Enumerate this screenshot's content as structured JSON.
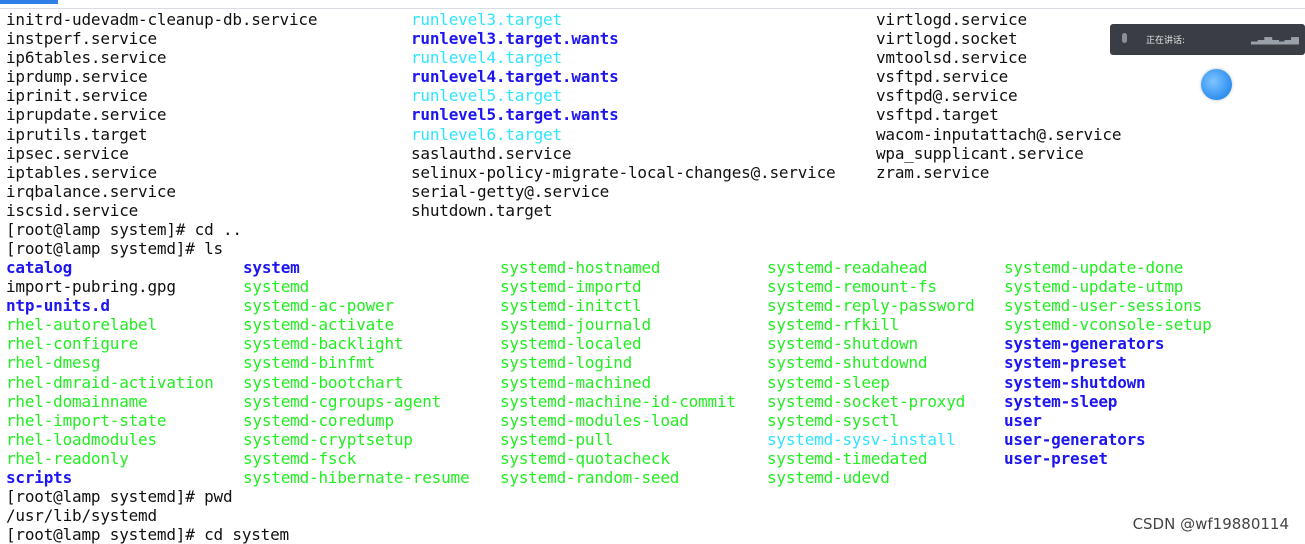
{
  "window": {
    "accent_color": "#2f7fe6"
  },
  "colors": {
    "cyan": "#2fe4ff",
    "bold_blue": "#1e16f0",
    "green": "#22ee22",
    "text": "#111111"
  },
  "listing1": {
    "col1": [
      "initrd-udevadm-cleanup-db.service",
      "instperf.service",
      "ip6tables.service",
      "iprdump.service",
      "iprinit.service",
      "iprupdate.service",
      "iprutils.target",
      "ipsec.service",
      "iptables.service",
      "irqbalance.service",
      "iscsid.service"
    ],
    "col2": [
      {
        "text": "runlevel3.target",
        "style": "cyan"
      },
      {
        "text": "runlevel3.target.wants",
        "style": "bblue"
      },
      {
        "text": "runlevel4.target",
        "style": "cyan"
      },
      {
        "text": "runlevel4.target.wants",
        "style": "bblue"
      },
      {
        "text": "runlevel5.target",
        "style": "cyan"
      },
      {
        "text": "runlevel5.target.wants",
        "style": "bblue"
      },
      {
        "text": "runlevel6.target",
        "style": "cyan"
      },
      {
        "text": "saslauthd.service",
        "style": ""
      },
      {
        "text": "selinux-policy-migrate-local-changes@.service",
        "style": ""
      },
      {
        "text": "serial-getty@.service",
        "style": ""
      },
      {
        "text": "shutdown.target",
        "style": ""
      }
    ],
    "col3": [
      "virtlogd.service",
      "virtlogd.socket",
      "vmtoolsd.service",
      "vsftpd.service",
      "vsftpd@.service",
      "vsftpd.target",
      "wacom-inputattach@.service",
      "wpa_supplicant.service",
      "zram.service"
    ]
  },
  "prompt_lines": {
    "cd_up": "[root@lamp system]# cd ..",
    "ls_cmd": "[root@lamp systemd]# ls",
    "pwd_cmd": "[root@lamp systemd]# pwd",
    "pwd_out": "/usr/lib/systemd",
    "cd_system": "[root@lamp systemd]# cd system"
  },
  "listing2": {
    "col1": [
      {
        "text": "catalog",
        "style": "bblue"
      },
      {
        "text": "import-pubring.gpg",
        "style": ""
      },
      {
        "text": "ntp-units.d",
        "style": "bblue"
      },
      {
        "text": "rhel-autorelabel",
        "style": "green"
      },
      {
        "text": "rhel-configure",
        "style": "green"
      },
      {
        "text": "rhel-dmesg",
        "style": "green"
      },
      {
        "text": "rhel-dmraid-activation",
        "style": "green"
      },
      {
        "text": "rhel-domainname",
        "style": "green"
      },
      {
        "text": "rhel-import-state",
        "style": "green"
      },
      {
        "text": "rhel-loadmodules",
        "style": "green"
      },
      {
        "text": "rhel-readonly",
        "style": "green"
      },
      {
        "text": "scripts",
        "style": "bblue"
      }
    ],
    "col2": [
      {
        "text": "system",
        "style": "bblue"
      },
      {
        "text": "systemd",
        "style": "green"
      },
      {
        "text": "systemd-ac-power",
        "style": "green"
      },
      {
        "text": "systemd-activate",
        "style": "green"
      },
      {
        "text": "systemd-backlight",
        "style": "green"
      },
      {
        "text": "systemd-binfmt",
        "style": "green"
      },
      {
        "text": "systemd-bootchart",
        "style": "green"
      },
      {
        "text": "systemd-cgroups-agent",
        "style": "green"
      },
      {
        "text": "systemd-coredump",
        "style": "green"
      },
      {
        "text": "systemd-cryptsetup",
        "style": "green"
      },
      {
        "text": "systemd-fsck",
        "style": "green"
      },
      {
        "text": "systemd-hibernate-resume",
        "style": "green"
      }
    ],
    "col3": [
      {
        "text": "systemd-hostnamed",
        "style": "green"
      },
      {
        "text": "systemd-importd",
        "style": "green"
      },
      {
        "text": "systemd-initctl",
        "style": "green"
      },
      {
        "text": "systemd-journald",
        "style": "green"
      },
      {
        "text": "systemd-localed",
        "style": "green"
      },
      {
        "text": "systemd-logind",
        "style": "green"
      },
      {
        "text": "systemd-machined",
        "style": "green"
      },
      {
        "text": "systemd-machine-id-commit",
        "style": "green"
      },
      {
        "text": "systemd-modules-load",
        "style": "green"
      },
      {
        "text": "systemd-pull",
        "style": "green"
      },
      {
        "text": "systemd-quotacheck",
        "style": "green"
      },
      {
        "text": "systemd-random-seed",
        "style": "green"
      }
    ],
    "col4": [
      {
        "text": "systemd-readahead",
        "style": "green"
      },
      {
        "text": "systemd-remount-fs",
        "style": "green"
      },
      {
        "text": "systemd-reply-password",
        "style": "green"
      },
      {
        "text": "systemd-rfkill",
        "style": "green"
      },
      {
        "text": "systemd-shutdown",
        "style": "green"
      },
      {
        "text": "systemd-shutdownd",
        "style": "green"
      },
      {
        "text": "systemd-sleep",
        "style": "green"
      },
      {
        "text": "systemd-socket-proxyd",
        "style": "green"
      },
      {
        "text": "systemd-sysctl",
        "style": "green"
      },
      {
        "text": "systemd-sysv-install",
        "style": "cyan"
      },
      {
        "text": "systemd-timedated",
        "style": "green"
      },
      {
        "text": "systemd-udevd",
        "style": "green"
      }
    ],
    "col5": [
      {
        "text": "systemd-update-done",
        "style": "green"
      },
      {
        "text": "systemd-update-utmp",
        "style": "green"
      },
      {
        "text": "systemd-user-sessions",
        "style": "green"
      },
      {
        "text": "systemd-vconsole-setup",
        "style": "green"
      },
      {
        "text": "system-generators",
        "style": "bblue"
      },
      {
        "text": "system-preset",
        "style": "bblue"
      },
      {
        "text": "system-shutdown",
        "style": "bblue"
      },
      {
        "text": "system-sleep",
        "style": "bblue"
      },
      {
        "text": "user",
        "style": "bblue"
      },
      {
        "text": "user-generators",
        "style": "bblue"
      },
      {
        "text": "user-preset",
        "style": "bblue"
      }
    ]
  },
  "voice_popup": {
    "label": "正在讲话:",
    "icon": "mic-icon"
  },
  "watermark": "CSDN @wf19880114"
}
